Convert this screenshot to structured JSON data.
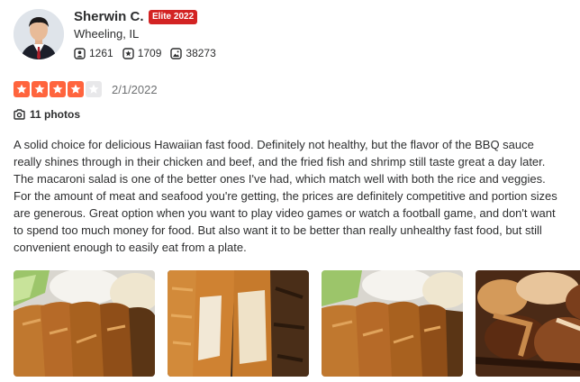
{
  "user": {
    "name": "Sherwin C.",
    "elite_badge": "Elite 2022",
    "location": "Wheeling, IL",
    "stats": [
      {
        "icon": "friends-icon",
        "value": "1261"
      },
      {
        "icon": "reviews-icon",
        "value": "1709"
      },
      {
        "icon": "photos-icon",
        "value": "38273"
      }
    ]
  },
  "review": {
    "rating": 4,
    "rating_max": 5,
    "date": "2/1/2022",
    "photo_count_label": "11 photos",
    "text": "A solid choice for delicious Hawaiian fast food. Definitely not healthy, but the flavor of the BBQ sauce really shines through in their chicken and beef, and the fried fish and shrimp still taste great a day later. The macaroni salad is one of the better ones I've had, which match well with both the rice and veggies. For the amount of meat and seafood you're getting, the prices are definitely competitive and portion sizes are generous. Great option when you want to play video games or watch a football game, and don't want to spend too much money for food. But also want it to be better than really unhealthy fast food, but still convenient enough to easily eat from a plate."
  },
  "colors": {
    "star_on": "#ff643d",
    "star_off": "#e8e8ea",
    "elite": "#d32323"
  }
}
